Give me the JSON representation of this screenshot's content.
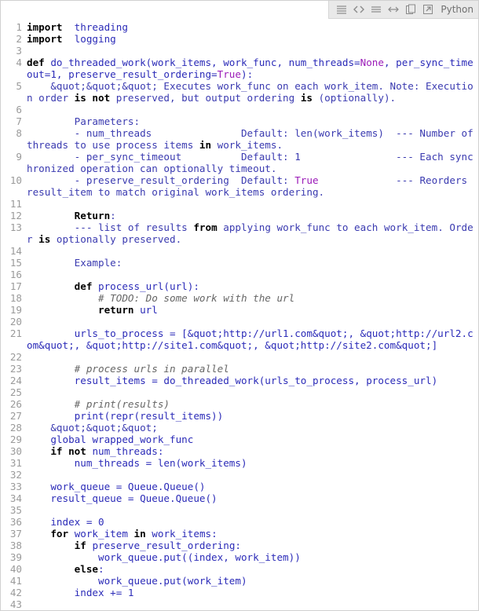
{
  "toolbar": {
    "icons": [
      "view-source-icon",
      "code-icon",
      "wrap-icon",
      "expand-icon",
      "copy-icon",
      "popout-icon"
    ],
    "language": "Python"
  },
  "code": {
    "lines": [
      [
        [
          "kw",
          "import"
        ],
        [
          "",
          "  "
        ],
        [
          "id",
          "threading"
        ]
      ],
      [
        [
          "kw",
          "import"
        ],
        [
          "",
          "  "
        ],
        [
          "id",
          "logging"
        ]
      ],
      [],
      [
        [
          "kw",
          "def"
        ],
        [
          "",
          " "
        ],
        [
          "id",
          "do_threaded_work(work_items, work_func, num_threads="
        ],
        [
          "cst",
          "None"
        ],
        [
          "id",
          ", per_sync_timeout=1, preserve_result_ordering="
        ],
        [
          "cst",
          "True"
        ],
        [
          "id",
          "):"
        ]
      ],
      [
        [
          "",
          "    "
        ],
        [
          "str",
          "&quot;&quot;&quot; Executes work_func on each work_item. Note: Execution order "
        ],
        [
          "kw",
          "is not"
        ],
        [
          "str",
          " preserved, but output ordering "
        ],
        [
          "kw",
          "is"
        ],
        [
          "str",
          " (optionally)."
        ]
      ],
      [],
      [
        [
          "",
          "        "
        ],
        [
          "str",
          "Parameters:"
        ]
      ],
      [
        [
          "",
          "        "
        ],
        [
          "str",
          "- num_threads               Default: len(work_items)  --- Number of threads to use process items "
        ],
        [
          "kw",
          "in"
        ],
        [
          "str",
          " work_items."
        ]
      ],
      [
        [
          "",
          "        "
        ],
        [
          "str",
          "- per_sync_timeout          Default: 1                --- Each synchronized operation can optionally timeout."
        ]
      ],
      [
        [
          "",
          "        "
        ],
        [
          "str",
          "- preserve_result_ordering  Default: "
        ],
        [
          "cst",
          "True"
        ],
        [
          "str",
          "             --- Reorders result_item to match original work_items ordering."
        ]
      ],
      [],
      [
        [
          "",
          "        "
        ],
        [
          "kw",
          "Return"
        ],
        [
          "str",
          ":"
        ]
      ],
      [
        [
          "",
          "        "
        ],
        [
          "str",
          "--- list of results "
        ],
        [
          "kw",
          "from"
        ],
        [
          "str",
          " applying work_func to each work_item. Order "
        ],
        [
          "kw",
          "is"
        ],
        [
          "str",
          " optionally preserved."
        ]
      ],
      [],
      [
        [
          "",
          "        "
        ],
        [
          "str",
          "Example:"
        ]
      ],
      [],
      [
        [
          "",
          "        "
        ],
        [
          "kw",
          "def"
        ],
        [
          "",
          " "
        ],
        [
          "id",
          "process_url(url):"
        ]
      ],
      [
        [
          "",
          "            "
        ],
        [
          "cm",
          "# TODO: Do some work with the url"
        ]
      ],
      [
        [
          "",
          "            "
        ],
        [
          "kw",
          "return"
        ],
        [
          "",
          " "
        ],
        [
          "id",
          "url"
        ]
      ],
      [],
      [
        [
          "",
          "        "
        ],
        [
          "id",
          "urls_to_process = [&quot;http://url1.com&quot;, &quot;http://url2.com&quot;, &quot;http://site1.com&quot;, &quot;http://site2.com&quot;]"
        ]
      ],
      [],
      [
        [
          "",
          "        "
        ],
        [
          "cm",
          "# process urls in parallel"
        ]
      ],
      [
        [
          "",
          "        "
        ],
        [
          "id",
          "result_items = do_threaded_work(urls_to_process, process_url)"
        ]
      ],
      [],
      [
        [
          "",
          "        "
        ],
        [
          "cm",
          "# print(results)"
        ]
      ],
      [
        [
          "",
          "        "
        ],
        [
          "id",
          "print(repr(result_items))"
        ]
      ],
      [
        [
          "",
          "    "
        ],
        [
          "str",
          "&quot;&quot;&quot;"
        ]
      ],
      [
        [
          "",
          "    "
        ],
        [
          "id",
          "global wrapped_work_func"
        ]
      ],
      [
        [
          "",
          "    "
        ],
        [
          "kw",
          "if not"
        ],
        [
          "",
          " "
        ],
        [
          "id",
          "num_threads:"
        ]
      ],
      [
        [
          "",
          "        "
        ],
        [
          "id",
          "num_threads = len(work_items)"
        ]
      ],
      [],
      [
        [
          "",
          "    "
        ],
        [
          "id",
          "work_queue = Queue.Queue()"
        ]
      ],
      [
        [
          "",
          "    "
        ],
        [
          "id",
          "result_queue = Queue.Queue()"
        ]
      ],
      [],
      [
        [
          "",
          "    "
        ],
        [
          "id",
          "index = 0"
        ]
      ],
      [
        [
          "",
          "    "
        ],
        [
          "kw",
          "for"
        ],
        [
          "",
          " "
        ],
        [
          "id",
          "work_item "
        ],
        [
          "kw",
          "in"
        ],
        [
          "",
          " "
        ],
        [
          "id",
          "work_items:"
        ]
      ],
      [
        [
          "",
          "        "
        ],
        [
          "kw",
          "if"
        ],
        [
          "",
          " "
        ],
        [
          "id",
          "preserve_result_ordering:"
        ]
      ],
      [
        [
          "",
          "            "
        ],
        [
          "id",
          "work_queue.put((index, work_item))"
        ]
      ],
      [
        [
          "",
          "        "
        ],
        [
          "kw",
          "else"
        ],
        [
          "id",
          ":"
        ]
      ],
      [
        [
          "",
          "            "
        ],
        [
          "id",
          "work_queue.put(work_item)"
        ]
      ],
      [
        [
          "",
          "        "
        ],
        [
          "id",
          "index "
        ],
        [
          "op",
          "+="
        ],
        [
          "id",
          " 1"
        ]
      ],
      []
    ]
  }
}
